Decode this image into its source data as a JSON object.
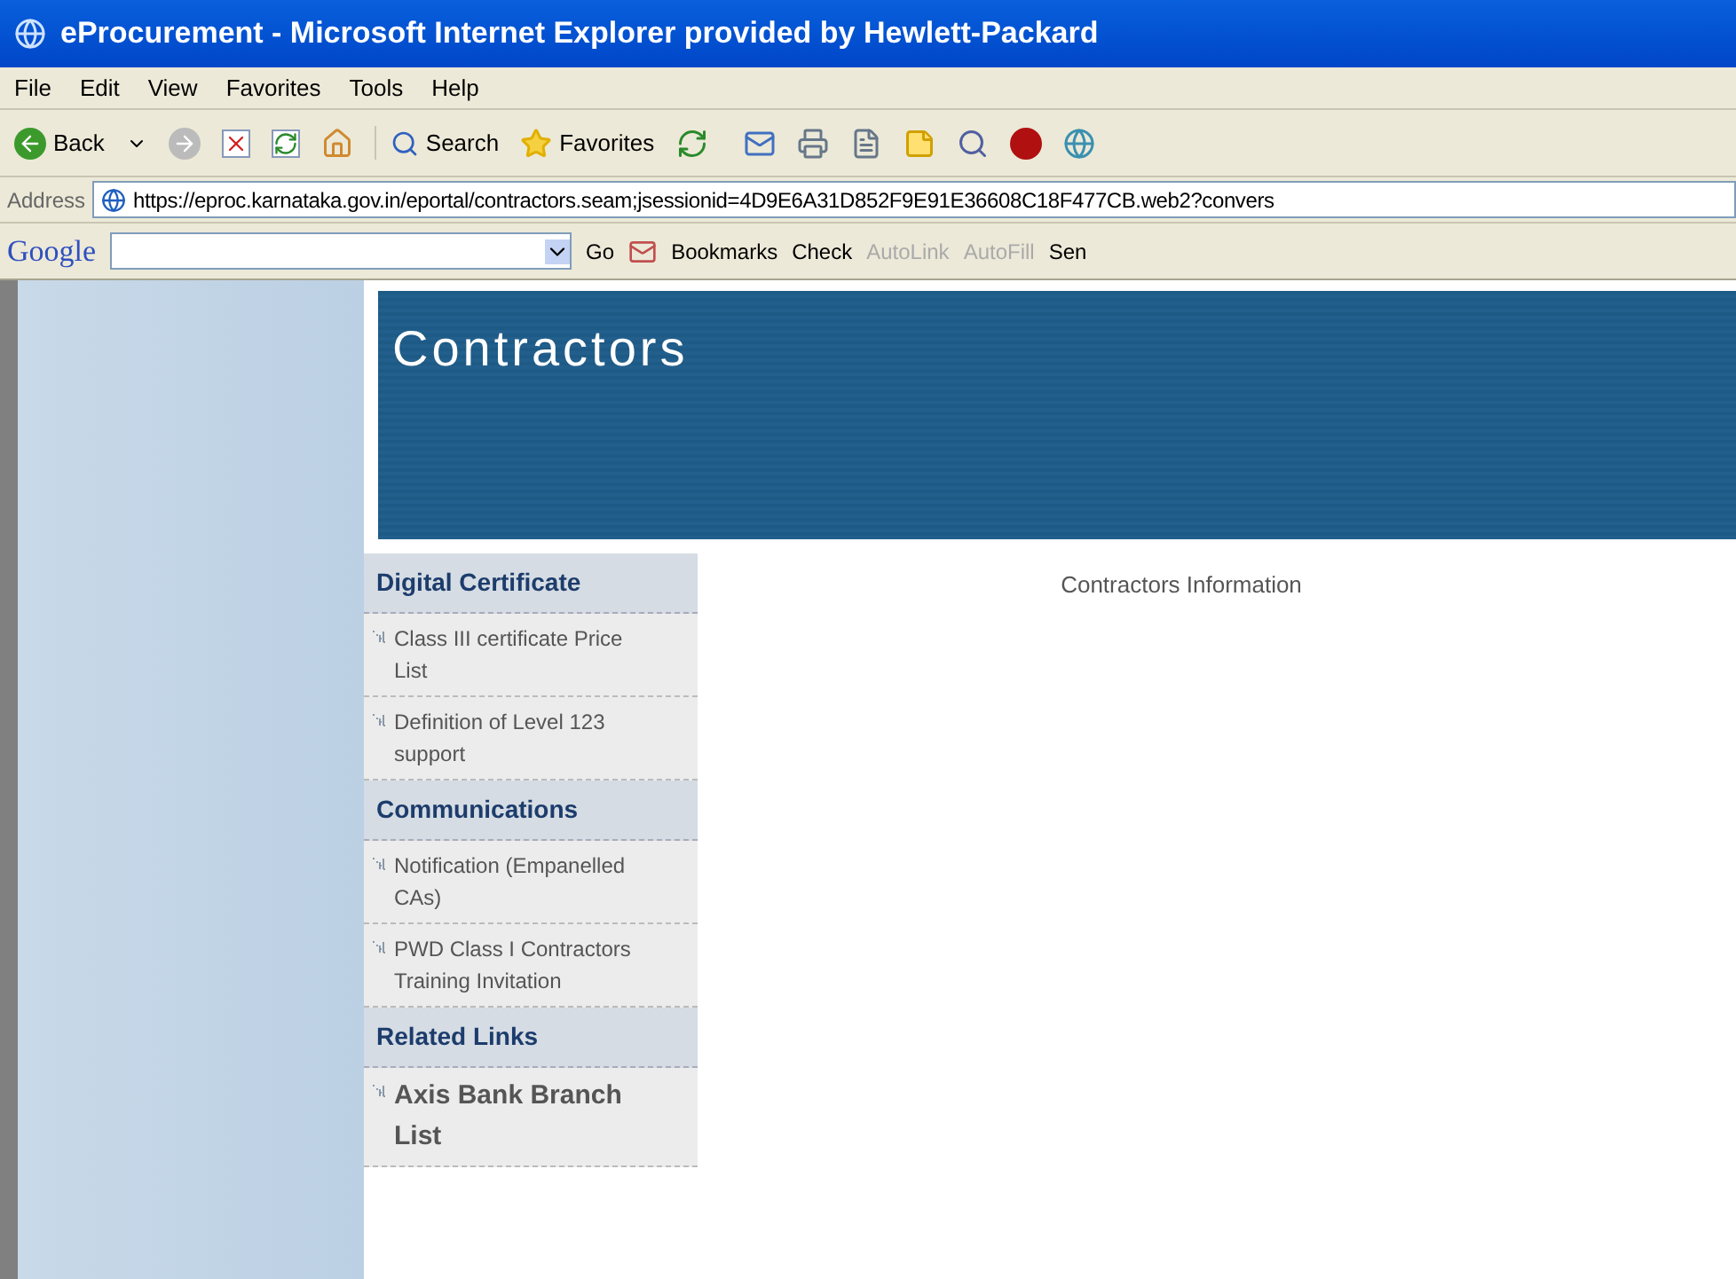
{
  "window": {
    "title": "eProcurement - Microsoft Internet Explorer provided by Hewlett-Packard"
  },
  "menu": [
    "File",
    "Edit",
    "View",
    "Favorites",
    "Tools",
    "Help"
  ],
  "toolbar": {
    "back": "Back",
    "search": "Search",
    "favorites": "Favorites"
  },
  "address": {
    "label": "Address",
    "value": "https://eproc.karnataka.gov.in/eportal/contractors.seam;jsessionid=4D9E6A31D852F9E91E36608C18F477CB.web2?convers"
  },
  "google_bar": {
    "logo": "Google",
    "go": "Go",
    "items": [
      {
        "label": "Bookmarks",
        "disabled": false
      },
      {
        "label": "Check",
        "disabled": false
      },
      {
        "label": "AutoLink",
        "disabled": true
      },
      {
        "label": "AutoFill",
        "disabled": true
      },
      {
        "label": "Sen",
        "disabled": false
      }
    ]
  },
  "banner": {
    "title": "Contractors"
  },
  "sidebar": [
    {
      "heading": "Digital Certificate",
      "items": [
        {
          "label": "Class III certificate Price List",
          "bold": false
        },
        {
          "label": "Definition of Level 123 support",
          "bold": false
        }
      ]
    },
    {
      "heading": "Communications",
      "items": [
        {
          "label": "Notification (Empanelled CAs)",
          "bold": false
        },
        {
          "label": "PWD Class I Contractors Training Invitation",
          "bold": false
        }
      ]
    },
    {
      "heading": "Related Links",
      "items": [
        {
          "label": "Axis Bank Branch List",
          "bold": true
        }
      ]
    }
  ],
  "content": {
    "text": "Contractors Information"
  }
}
